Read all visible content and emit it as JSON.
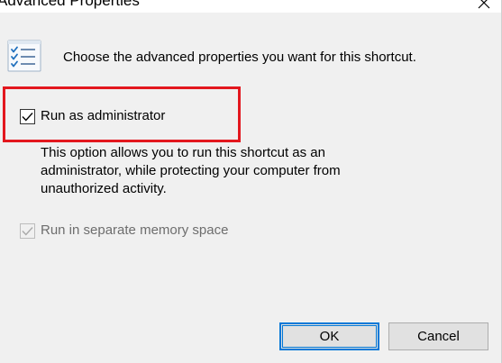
{
  "window": {
    "title": "Advanced Properties",
    "close_icon": "close-icon"
  },
  "header": {
    "icon": "properties-list-icon",
    "text": "Choose the advanced properties you want for this shortcut."
  },
  "options": {
    "run_as_admin": {
      "label": "Run as administrator",
      "checked": true,
      "enabled": true
    },
    "description_lines": [
      "This option allows you to run this shortcut as an",
      "administrator, while protecting your computer from",
      "unauthorized activity."
    ],
    "separate_memory": {
      "label": "Run in separate memory space",
      "checked": true,
      "enabled": false
    }
  },
  "buttons": {
    "ok_label": "OK",
    "cancel_label": "Cancel"
  },
  "colors": {
    "highlight_border": "#e3171e",
    "accent_blue": "#0078d7",
    "dialog_background": "#f0f0f0",
    "disabled_text": "#6d6d6d"
  }
}
